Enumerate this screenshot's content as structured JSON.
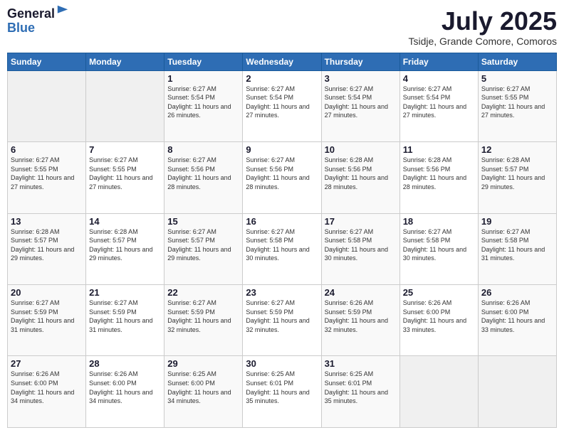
{
  "header": {
    "logo_general": "General",
    "logo_blue": "Blue",
    "main_title": "July 2025",
    "subtitle": "Tsidje, Grande Comore, Comoros"
  },
  "calendar": {
    "days_of_week": [
      "Sunday",
      "Monday",
      "Tuesday",
      "Wednesday",
      "Thursday",
      "Friday",
      "Saturday"
    ],
    "weeks": [
      [
        {
          "day": "",
          "info": ""
        },
        {
          "day": "",
          "info": ""
        },
        {
          "day": "1",
          "info": "Sunrise: 6:27 AM\nSunset: 5:54 PM\nDaylight: 11 hours and 26 minutes."
        },
        {
          "day": "2",
          "info": "Sunrise: 6:27 AM\nSunset: 5:54 PM\nDaylight: 11 hours and 27 minutes."
        },
        {
          "day": "3",
          "info": "Sunrise: 6:27 AM\nSunset: 5:54 PM\nDaylight: 11 hours and 27 minutes."
        },
        {
          "day": "4",
          "info": "Sunrise: 6:27 AM\nSunset: 5:54 PM\nDaylight: 11 hours and 27 minutes."
        },
        {
          "day": "5",
          "info": "Sunrise: 6:27 AM\nSunset: 5:55 PM\nDaylight: 11 hours and 27 minutes."
        }
      ],
      [
        {
          "day": "6",
          "info": "Sunrise: 6:27 AM\nSunset: 5:55 PM\nDaylight: 11 hours and 27 minutes."
        },
        {
          "day": "7",
          "info": "Sunrise: 6:27 AM\nSunset: 5:55 PM\nDaylight: 11 hours and 27 minutes."
        },
        {
          "day": "8",
          "info": "Sunrise: 6:27 AM\nSunset: 5:56 PM\nDaylight: 11 hours and 28 minutes."
        },
        {
          "day": "9",
          "info": "Sunrise: 6:27 AM\nSunset: 5:56 PM\nDaylight: 11 hours and 28 minutes."
        },
        {
          "day": "10",
          "info": "Sunrise: 6:28 AM\nSunset: 5:56 PM\nDaylight: 11 hours and 28 minutes."
        },
        {
          "day": "11",
          "info": "Sunrise: 6:28 AM\nSunset: 5:56 PM\nDaylight: 11 hours and 28 minutes."
        },
        {
          "day": "12",
          "info": "Sunrise: 6:28 AM\nSunset: 5:57 PM\nDaylight: 11 hours and 29 minutes."
        }
      ],
      [
        {
          "day": "13",
          "info": "Sunrise: 6:28 AM\nSunset: 5:57 PM\nDaylight: 11 hours and 29 minutes."
        },
        {
          "day": "14",
          "info": "Sunrise: 6:28 AM\nSunset: 5:57 PM\nDaylight: 11 hours and 29 minutes."
        },
        {
          "day": "15",
          "info": "Sunrise: 6:27 AM\nSunset: 5:57 PM\nDaylight: 11 hours and 29 minutes."
        },
        {
          "day": "16",
          "info": "Sunrise: 6:27 AM\nSunset: 5:58 PM\nDaylight: 11 hours and 30 minutes."
        },
        {
          "day": "17",
          "info": "Sunrise: 6:27 AM\nSunset: 5:58 PM\nDaylight: 11 hours and 30 minutes."
        },
        {
          "day": "18",
          "info": "Sunrise: 6:27 AM\nSunset: 5:58 PM\nDaylight: 11 hours and 30 minutes."
        },
        {
          "day": "19",
          "info": "Sunrise: 6:27 AM\nSunset: 5:58 PM\nDaylight: 11 hours and 31 minutes."
        }
      ],
      [
        {
          "day": "20",
          "info": "Sunrise: 6:27 AM\nSunset: 5:59 PM\nDaylight: 11 hours and 31 minutes."
        },
        {
          "day": "21",
          "info": "Sunrise: 6:27 AM\nSunset: 5:59 PM\nDaylight: 11 hours and 31 minutes."
        },
        {
          "day": "22",
          "info": "Sunrise: 6:27 AM\nSunset: 5:59 PM\nDaylight: 11 hours and 32 minutes."
        },
        {
          "day": "23",
          "info": "Sunrise: 6:27 AM\nSunset: 5:59 PM\nDaylight: 11 hours and 32 minutes."
        },
        {
          "day": "24",
          "info": "Sunrise: 6:26 AM\nSunset: 5:59 PM\nDaylight: 11 hours and 32 minutes."
        },
        {
          "day": "25",
          "info": "Sunrise: 6:26 AM\nSunset: 6:00 PM\nDaylight: 11 hours and 33 minutes."
        },
        {
          "day": "26",
          "info": "Sunrise: 6:26 AM\nSunset: 6:00 PM\nDaylight: 11 hours and 33 minutes."
        }
      ],
      [
        {
          "day": "27",
          "info": "Sunrise: 6:26 AM\nSunset: 6:00 PM\nDaylight: 11 hours and 34 minutes."
        },
        {
          "day": "28",
          "info": "Sunrise: 6:26 AM\nSunset: 6:00 PM\nDaylight: 11 hours and 34 minutes."
        },
        {
          "day": "29",
          "info": "Sunrise: 6:25 AM\nSunset: 6:00 PM\nDaylight: 11 hours and 34 minutes."
        },
        {
          "day": "30",
          "info": "Sunrise: 6:25 AM\nSunset: 6:01 PM\nDaylight: 11 hours and 35 minutes."
        },
        {
          "day": "31",
          "info": "Sunrise: 6:25 AM\nSunset: 6:01 PM\nDaylight: 11 hours and 35 minutes."
        },
        {
          "day": "",
          "info": ""
        },
        {
          "day": "",
          "info": ""
        }
      ]
    ]
  }
}
